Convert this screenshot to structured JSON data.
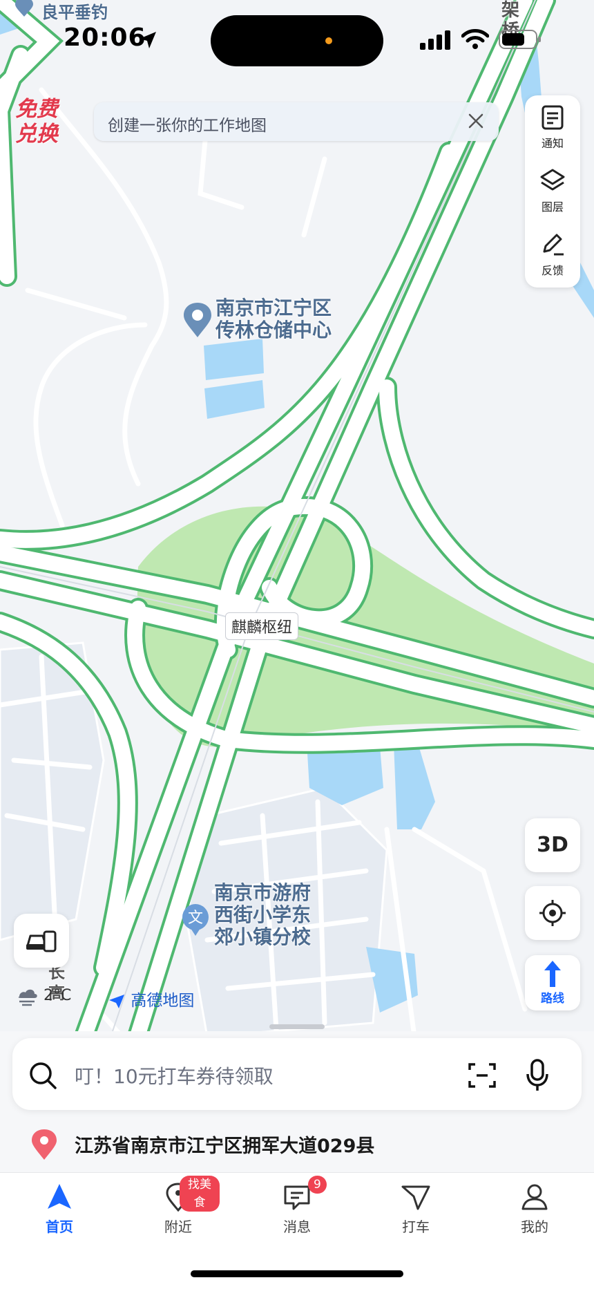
{
  "status_bar": {
    "time": "20:06"
  },
  "promo": {
    "line1": "免费",
    "line2": "兑换"
  },
  "map_tip": {
    "text": "创建一张你的工作地图"
  },
  "side_panel": {
    "notify": "通知",
    "layers": "图层",
    "feedback": "反馈"
  },
  "map": {
    "labels": {
      "top_left_poi": "良平垂钓",
      "warehouse_line1": "南京市江宁区",
      "warehouse_line2": "传林仓储中心",
      "interchange": "麒麟枢纽",
      "school_line1": "南京市游府",
      "school_line2": "西街小学东",
      "school_line3": "郊小镇分校",
      "road_top_right": "架桥",
      "road_bottom_left": "长高"
    },
    "colors": {
      "road_edge": "#4fb870",
      "green_area": "#bfe8b1",
      "water": "#a8d8f8",
      "land": "#f2f4f7"
    }
  },
  "controls": {
    "three_d": "3D",
    "route": "路线"
  },
  "weather": {
    "temp": "2°C"
  },
  "brand": {
    "name": "高德地图"
  },
  "search": {
    "placeholder": "叮！10元打车券待领取"
  },
  "location": {
    "address": "江苏省南京市江宁区拥军大道029县"
  },
  "tabs": [
    {
      "label": "首页",
      "active": true
    },
    {
      "label": "附近",
      "badge": "找美食"
    },
    {
      "label": "消息",
      "badge": "9"
    },
    {
      "label": "打车"
    },
    {
      "label": "我的"
    }
  ]
}
